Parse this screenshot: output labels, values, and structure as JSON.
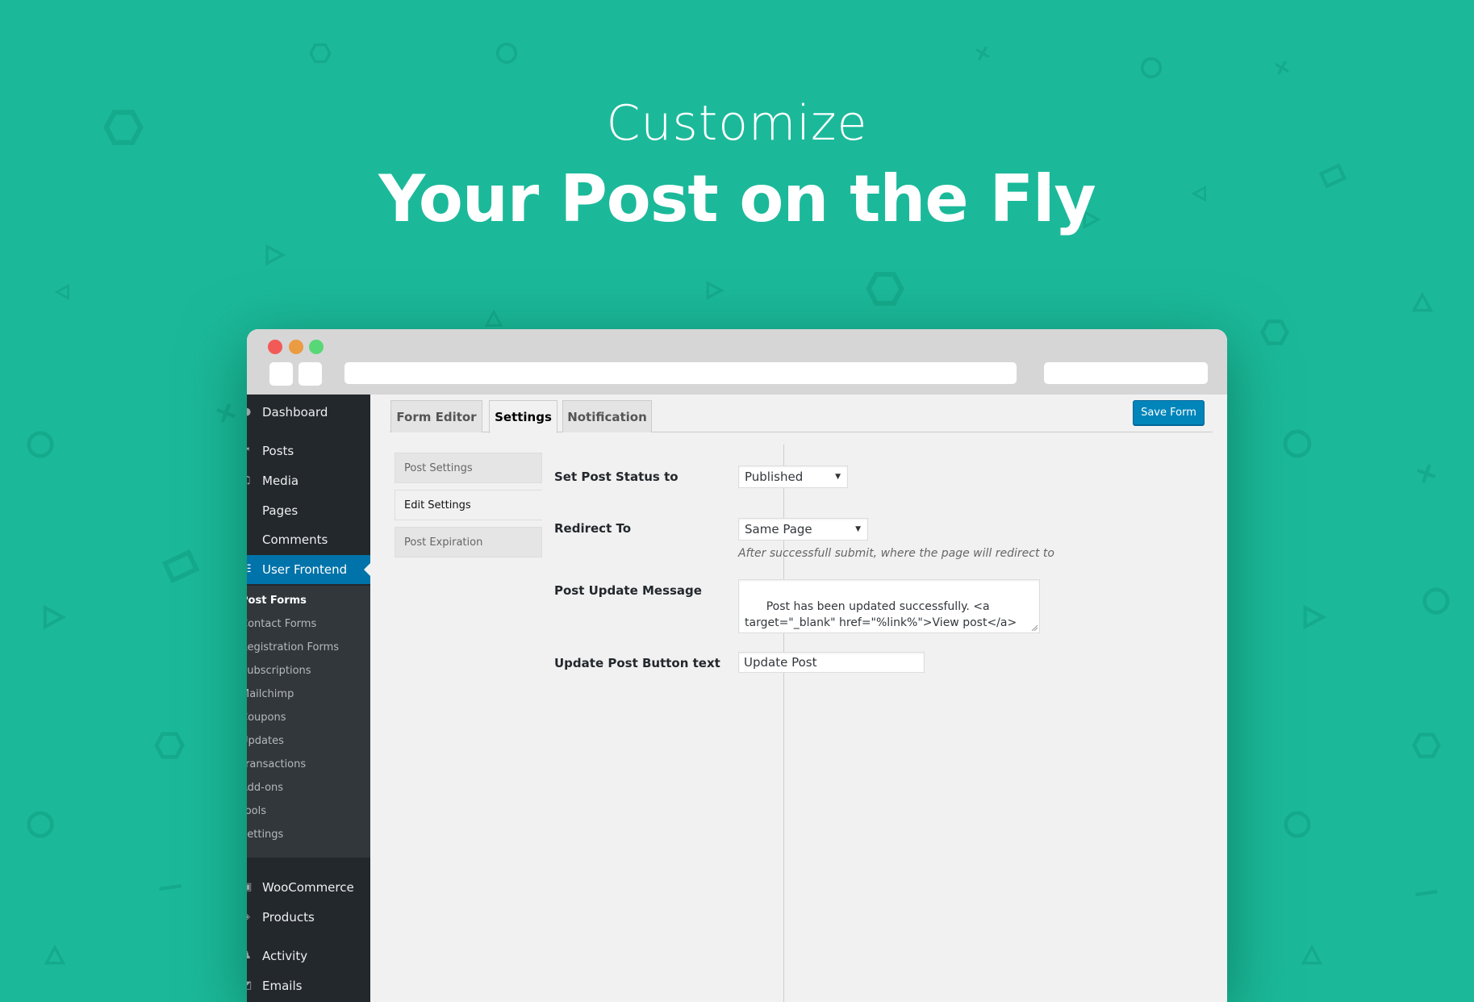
{
  "hero": {
    "subtitle": "Customize",
    "title": "Your Post on the Fly"
  },
  "colors": {
    "background": "#1bb99a",
    "sidebar": "#23282d",
    "submenu": "#32373c",
    "active_menu": "#0073aa",
    "primary_button": "#0085ba"
  },
  "browser": {
    "traffic_lights": [
      "close",
      "minimize",
      "maximize"
    ]
  },
  "sidebar": {
    "items": [
      {
        "label": "Dashboard",
        "icon": "dashboard-icon"
      },
      {
        "label": "Posts",
        "icon": "pin-icon"
      },
      {
        "label": "Media",
        "icon": "media-icon"
      },
      {
        "label": "Pages",
        "icon": "page-icon"
      },
      {
        "label": "Comments",
        "icon": "comment-icon"
      },
      {
        "label": "User Frontend",
        "icon": "form-icon",
        "active": true
      },
      {
        "label": "WooCommerce",
        "icon": "woocommerce-icon"
      },
      {
        "label": "Products",
        "icon": "product-icon"
      },
      {
        "label": "Activity",
        "icon": "activity-icon"
      },
      {
        "label": "Emails",
        "icon": "email-icon"
      }
    ],
    "submenu": [
      {
        "label": "Post Forms",
        "current": true
      },
      {
        "label": "Contact Forms"
      },
      {
        "label": "Registration Forms"
      },
      {
        "label": "Subscriptions"
      },
      {
        "label": "Mailchimp"
      },
      {
        "label": "Coupons"
      },
      {
        "label": "Updates"
      },
      {
        "label": "Transactions"
      },
      {
        "label": "Add-ons"
      },
      {
        "label": "Tools"
      },
      {
        "label": "Settings"
      }
    ]
  },
  "tabs": [
    {
      "label": "Form Editor"
    },
    {
      "label": "Settings",
      "active": true
    },
    {
      "label": "Notification"
    }
  ],
  "toolbar": {
    "save_label": "Save Form"
  },
  "subtabs": [
    {
      "label": "Post Settings"
    },
    {
      "label": "Edit Settings",
      "active": true
    },
    {
      "label": "Post Expiration"
    }
  ],
  "form": {
    "post_status": {
      "label": "Set Post Status to",
      "value": "Published"
    },
    "redirect": {
      "label": "Redirect To",
      "value": "Same Page",
      "help": "After successfull submit, where the page will redirect to"
    },
    "update_message": {
      "label": "Post Update Message",
      "value": "Post has been updated successfully. <a\ntarget=\"_blank\" href=\"%link%\">View post</a>"
    },
    "button_text": {
      "label": "Update Post Button text",
      "value": "Update Post"
    }
  }
}
